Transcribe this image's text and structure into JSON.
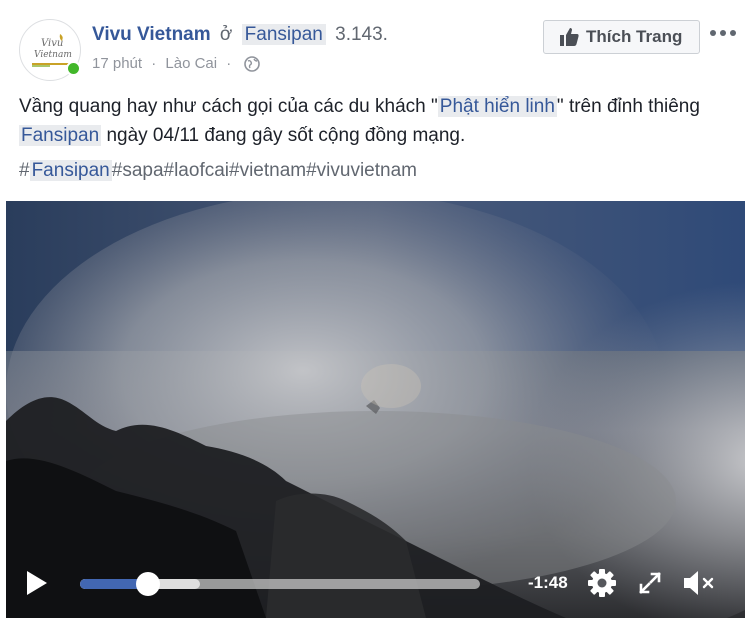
{
  "post": {
    "author": "Vivu Vietnam",
    "connector": "ở",
    "place": "Fansipan",
    "count": "3.143.",
    "time": "17 phút",
    "location": "Lào Cai",
    "privacy_icon": "globe-icon",
    "avatar_logo_text_1": "Vivu",
    "avatar_logo_text_2": "Vietnam",
    "like_page_label": "Thích Trang",
    "text_part1": "Vầng quang hay như cách gọi của các du khách \"",
    "text_highlight1": "Phật hiển linh",
    "text_part2": "\" trên đỉnh thiêng ",
    "text_highlight2": "Fansipan",
    "text_part3": " ngày 04/11 đang gây sốt cộng đồng mạng.",
    "hashtag_hash": "#",
    "hashtag_first": "Fansipan",
    "hashtags_rest": "#sapa#laofcai#vietnam#vivuvietnam"
  },
  "video": {
    "time_remaining": "-1:48",
    "progress": 0.17,
    "buffered": 0.3
  },
  "colors": {
    "link": "#365899",
    "progress": "#4267b2",
    "online": "#42b72a"
  }
}
